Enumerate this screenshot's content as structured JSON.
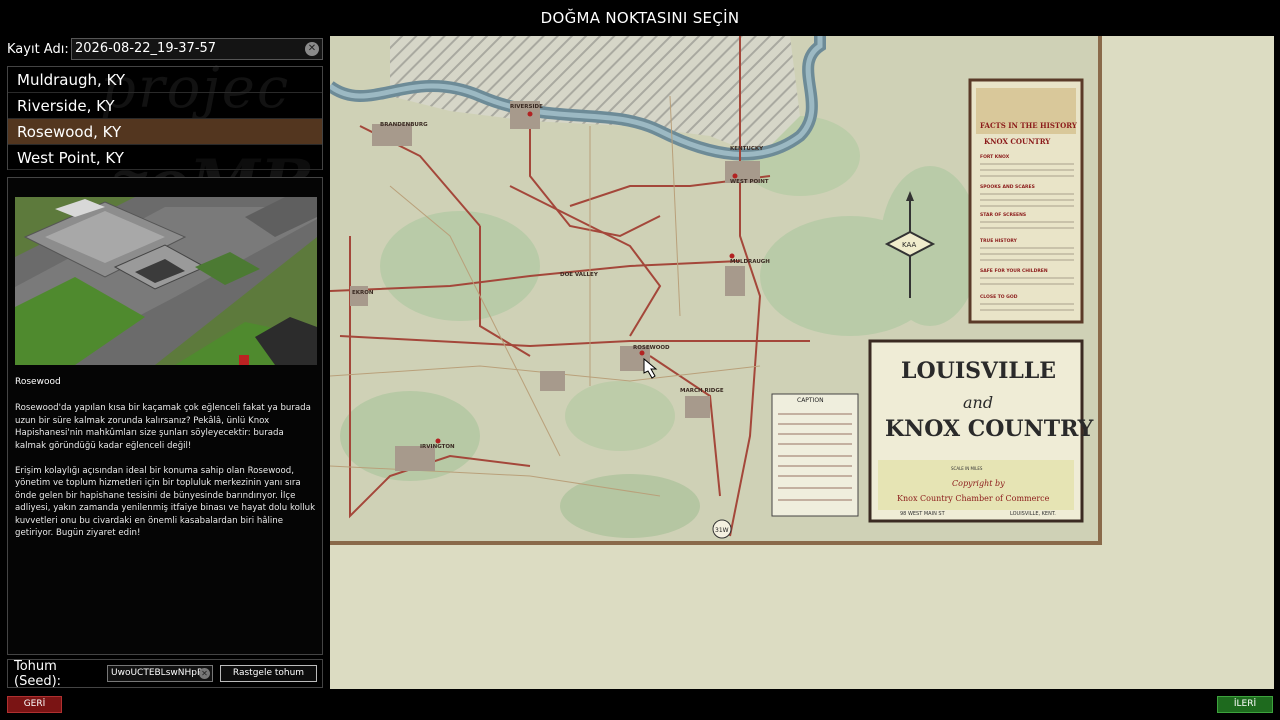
{
  "header": {
    "title": "DOĞMA NOKTASINI SEÇİN"
  },
  "save": {
    "label": "Kayıt Adı:",
    "value": "2026-08-22_19-37-57",
    "clear_icon": "clear-x-icon"
  },
  "towns": [
    {
      "label": "Muldraugh, KY"
    },
    {
      "label": "Riverside, KY"
    },
    {
      "label": "Rosewood, KY"
    },
    {
      "label": "West Point, KY"
    }
  ],
  "selected_town_index": 2,
  "info": {
    "title": "Rosewood",
    "paragraph1": "Rosewood'da yapılan kısa bir kaçamak çok eğlenceli fakat ya burada uzun bir süre kalmak zorunda kalırsanız? Pekâlâ, ünlü Knox Hapishanesi'nin mahkûmları size şunları söyleyecektir: burada kalmak göründüğü kadar eğlenceli değil!",
    "paragraph2": "Erişim kolaylığı açısından ideal bir konuma sahip olan Rosewood, yönetim ve toplum hizmetleri için bir topluluk merkezinin yanı sıra önde gelen bir hapishane tesisini de bünyesinde barındırıyor. İlçe adliyesi, yakın zamanda yenilenmiş itfaiye binası ve hayat dolu kolluk kuvvetleri onu bu civardaki en önemli kasabalardan biri hâline getiriyor. Bugün ziyaret edin!"
  },
  "seed": {
    "label": "Tohum (Seed):",
    "value": "UwoUCTEBLswNHpRb",
    "random_button": "Rastgele tohum"
  },
  "map": {
    "town_labels": [
      "RIVERSIDE",
      "BRANDENBURG",
      "WEST POINT",
      "MULDRAUGH",
      "EKRON",
      "ROSEWOOD",
      "IRVINGTON",
      "MARCH RIDGE",
      "KENTUCKY",
      "DOE VALLEY",
      "MULDRAUGH"
    ],
    "poster": {
      "line1": "LOUISVILLE",
      "line2": "and",
      "line3": "KNOX COUNTRY",
      "scale": "SCALE  IN  MILES",
      "copyright": "Copyright by",
      "chamber": "Knox Country Chamber of Commerce",
      "address": "98 WEST MAIN ST",
      "city": "LOUISVILLE, KENT."
    },
    "facts": {
      "title1": "FACTS IN THE HISTORY",
      "title2": "KNOX COUNTRY",
      "items": [
        "FORT KNOX",
        "SPOOKS AND SCARES",
        "STAR OF SCREENS",
        "TRUE HISTORY",
        "SAFE FOR YOUR CHILDREN",
        "CLOSE TO GOD"
      ]
    },
    "caption_title": "CAPTION",
    "compass_label": "KAA",
    "route_shield": "31W"
  },
  "footer": {
    "back_label": "GERİ",
    "next_label": "İLERİ"
  },
  "colors": {
    "selected_town": "#53361f",
    "back": "#7a1414",
    "next": "#1e6a1e",
    "map_bg": "#dcdcc2"
  }
}
